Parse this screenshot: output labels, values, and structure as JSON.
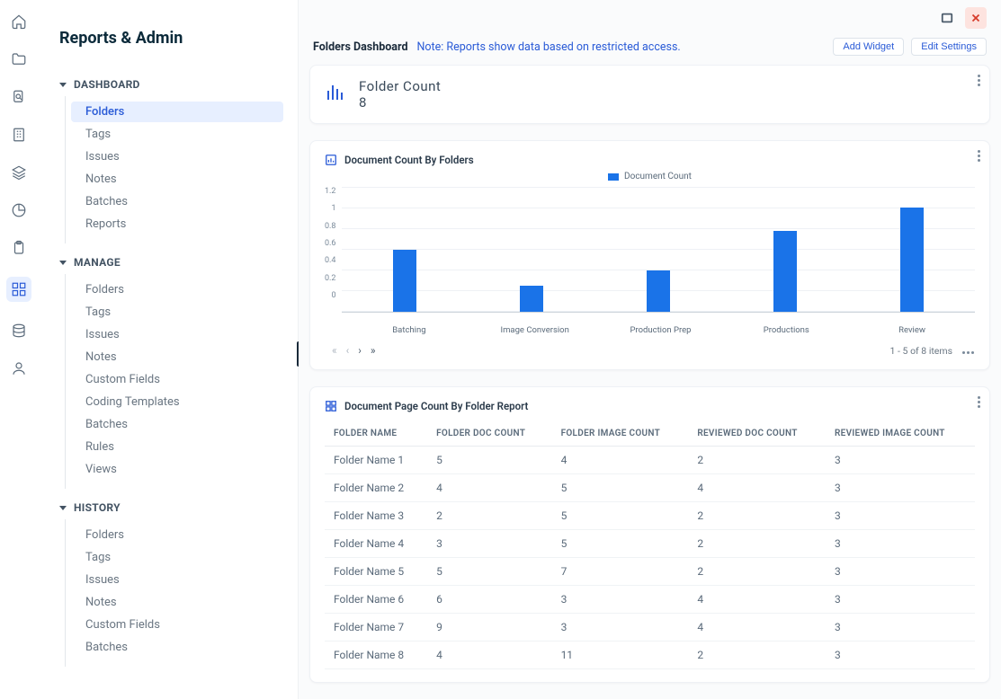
{
  "page_title": "Reports & Admin",
  "icon_rail": [
    "home",
    "folder",
    "search-doc",
    "building",
    "layers",
    "pie",
    "clipboard",
    "grid",
    "database",
    "user"
  ],
  "icon_rail_active_index": 7,
  "nav": {
    "sections": [
      {
        "label": "DASHBOARD",
        "items": [
          "Folders",
          "Tags",
          "Issues",
          "Notes",
          "Batches",
          "Reports"
        ],
        "active_index": 0
      },
      {
        "label": "MANAGE",
        "items": [
          "Folders",
          "Tags",
          "Issues",
          "Notes",
          "Custom Fields",
          "Coding Templates",
          "Batches",
          "Rules",
          "Views"
        ]
      },
      {
        "label": "HISTORY",
        "items": [
          "Folders",
          "Tags",
          "Issues",
          "Notes",
          "Custom Fields",
          "Batches"
        ]
      }
    ]
  },
  "header": {
    "title": "Folders Dashboard",
    "note": "Note: Reports show data based on restricted access.",
    "add_widget": "Add Widget",
    "edit_settings": "Edit Settings"
  },
  "kpi": {
    "label": "Folder  Count",
    "value": "8"
  },
  "chart_data": {
    "type": "bar",
    "title": "Document Count By Folders",
    "legend": "Document Count",
    "categories": [
      "Batching",
      "Image Conversion",
      "Production Prep",
      "Productions",
      "Review"
    ],
    "values": [
      0.6,
      0.25,
      0.4,
      0.78,
      1.0
    ],
    "ylim": [
      0,
      1.2
    ],
    "yticks": [
      "1.2",
      "1",
      "0.8",
      "0.6",
      "0.4",
      "0.2",
      "0"
    ],
    "pager_text": "1 - 5 of 8 items"
  },
  "table": {
    "title": "Document Page Count By Folder Report",
    "columns": [
      "FOLDER NAME",
      "FOLDER DOC COUNT",
      "FOLDER IMAGE COUNT",
      "REVIEWED DOC COUNT",
      "REVIEWED IMAGE COUNT"
    ],
    "rows": [
      [
        "Folder Name 1",
        "5",
        "4",
        "2",
        "3"
      ],
      [
        "Folder Name 2",
        "4",
        "5",
        "4",
        "3"
      ],
      [
        "Folder Name 3",
        "2",
        "5",
        "2",
        "3"
      ],
      [
        "Folder Name 4",
        "3",
        "5",
        "2",
        "3"
      ],
      [
        "Folder Name 5",
        "5",
        "7",
        "2",
        "3"
      ],
      [
        "Folder Name 6",
        "6",
        "3",
        "4",
        "3"
      ],
      [
        "Folder Name 7",
        "9",
        "3",
        "4",
        "3"
      ],
      [
        "Folder Name 8",
        "4",
        "11",
        "2",
        "3"
      ]
    ]
  }
}
